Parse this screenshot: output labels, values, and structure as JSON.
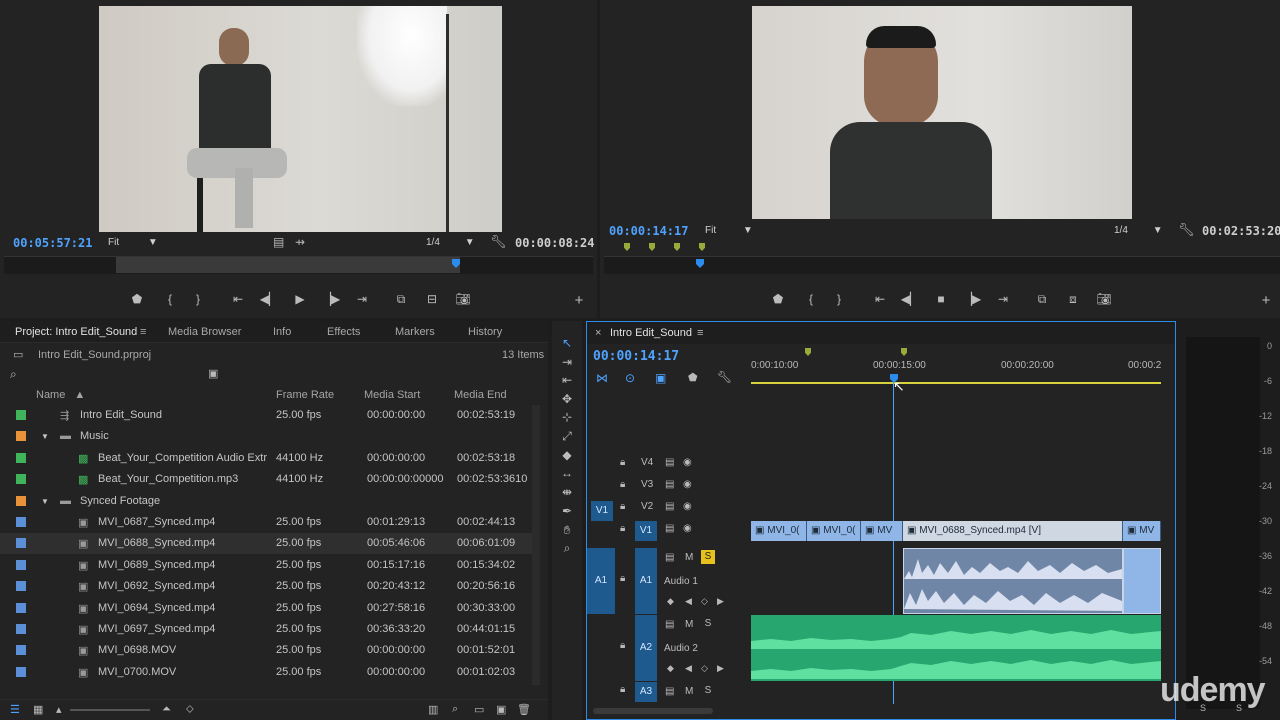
{
  "source_monitor": {
    "timecode": "00:05:57:21",
    "fit": "Fit",
    "resolution": "1/4",
    "duration": "00:00:08:24"
  },
  "program_monitor": {
    "timecode": "00:00:14:17",
    "fit": "Fit",
    "resolution": "1/4",
    "duration": "00:02:53:20"
  },
  "project": {
    "tabs": [
      "Project: Intro Edit_Sound",
      "Media Browser",
      "Info",
      "Effects",
      "Markers",
      "History"
    ],
    "file": "Intro Edit_Sound.prproj",
    "item_count": "13 Items",
    "columns": [
      "Name",
      "Frame Rate",
      "Media Start",
      "Media End"
    ],
    "rows": [
      {
        "name": "Intro Edit_Sound",
        "rate": "25.00 fps",
        "start": "00:00:00:00",
        "end": "00:02:53:19",
        "color": "#3fb45a",
        "indent": 1,
        "type": "seq"
      },
      {
        "name": "Music",
        "rate": "",
        "start": "",
        "end": "",
        "color": "#e8933a",
        "indent": 0,
        "type": "folder"
      },
      {
        "name": "Beat_Your_Competition Audio Extr",
        "rate": "44100 Hz",
        "start": "00:00:00:00",
        "end": "00:02:53:18",
        "color": "#3fb45a",
        "indent": 2,
        "type": "audio"
      },
      {
        "name": "Beat_Your_Competition.mp3",
        "rate": "44100 Hz",
        "start": "00:00:00:00000",
        "end": "00:02:53:3610",
        "color": "#3fb45a",
        "indent": 2,
        "type": "audio"
      },
      {
        "name": "Synced Footage",
        "rate": "",
        "start": "",
        "end": "",
        "color": "#e8933a",
        "indent": 0,
        "type": "folder"
      },
      {
        "name": "MVI_0687_Synced.mp4",
        "rate": "25.00 fps",
        "start": "00:01:29:13",
        "end": "00:02:44:13",
        "color": "#5b8fd6",
        "indent": 2,
        "type": "video"
      },
      {
        "name": "MVI_0688_Synced.mp4",
        "rate": "25.00 fps",
        "start": "00:05:46:06",
        "end": "00:06:01:09",
        "color": "#5b8fd6",
        "indent": 2,
        "type": "video"
      },
      {
        "name": "MVI_0689_Synced.mp4",
        "rate": "25.00 fps",
        "start": "00:15:17:16",
        "end": "00:15:34:02",
        "color": "#5b8fd6",
        "indent": 2,
        "type": "video"
      },
      {
        "name": "MVI_0692_Synced.mp4",
        "rate": "25.00 fps",
        "start": "00:20:43:12",
        "end": "00:20:56:16",
        "color": "#5b8fd6",
        "indent": 2,
        "type": "video"
      },
      {
        "name": "MVI_0694_Synced.mp4",
        "rate": "25.00 fps",
        "start": "00:27:58:16",
        "end": "00:30:33:00",
        "color": "#5b8fd6",
        "indent": 2,
        "type": "video"
      },
      {
        "name": "MVI_0697_Synced.mp4",
        "rate": "25.00 fps",
        "start": "00:36:33:20",
        "end": "00:44:01:15",
        "color": "#5b8fd6",
        "indent": 2,
        "type": "video"
      },
      {
        "name": "MVI_0698.MOV",
        "rate": "25.00 fps",
        "start": "00:00:00:00",
        "end": "00:01:52:01",
        "color": "#5b8fd6",
        "indent": 2,
        "type": "video"
      },
      {
        "name": "MVI_0700.MOV",
        "rate": "25.00 fps",
        "start": "00:00:00:00",
        "end": "00:01:02:03",
        "color": "#5b8fd6",
        "indent": 2,
        "type": "video"
      }
    ]
  },
  "timeline": {
    "tab": "Intro Edit_Sound",
    "timecode": "00:00:14:17",
    "ruler": [
      "0:00:10:00",
      "00:00:15:00",
      "00:00:20:00",
      "00:00:2"
    ],
    "tracks_video": [
      "V4",
      "V3",
      "V2",
      "V1"
    ],
    "source_v": "V1",
    "source_a": "A1",
    "tracks_audio": [
      {
        "id": "A1",
        "name": "Audio 1"
      },
      {
        "id": "A2",
        "name": "Audio 2"
      },
      {
        "id": "A3",
        "name": ""
      }
    ],
    "clips_v1": [
      "MVI_0(",
      "MVI_0(",
      "MV",
      "MVI_0688_Synced.mp4 [V]",
      "MV"
    ],
    "mute": "M",
    "solo": "S"
  },
  "meter": {
    "labels": [
      "0",
      "-6",
      "-12",
      "-18",
      "-24",
      "-30",
      "-36",
      "-42",
      "-48",
      "-54"
    ],
    "bottom": [
      "S",
      "S"
    ]
  },
  "watermark": "udemy"
}
